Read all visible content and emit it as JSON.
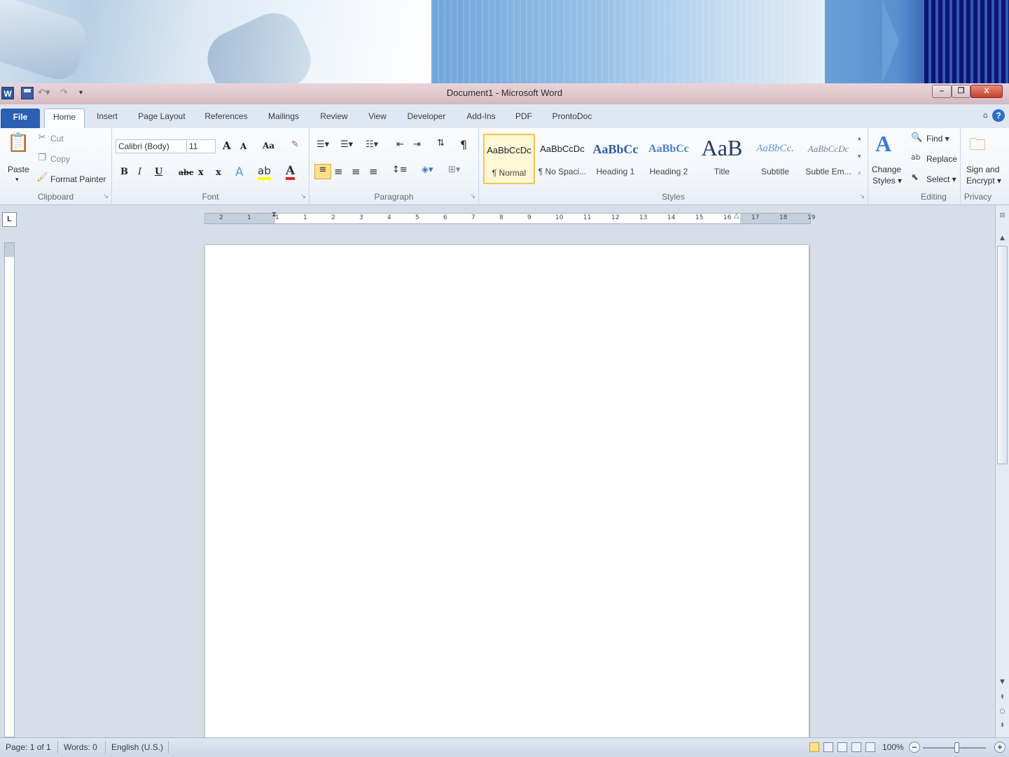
{
  "window": {
    "title": "Document1 - Microsoft Word",
    "min": "–",
    "max": "❐",
    "close": "X"
  },
  "qat": {
    "logo": "W",
    "more": "▾"
  },
  "tabs": [
    "File",
    "Home",
    "Insert",
    "Page Layout",
    "References",
    "Mailings",
    "Review",
    "View",
    "Developer",
    "Add-Ins",
    "PDF",
    "ProntoDoc"
  ],
  "clipboard": {
    "label": "Clipboard",
    "paste": "Paste",
    "cut": "Cut",
    "copy": "Copy",
    "format_painter": "Format Painter"
  },
  "font": {
    "label": "Font",
    "family": "Calibri (Body)",
    "size": "11",
    "grow": "A",
    "shrink": "A",
    "case": "Aa",
    "bold": "B",
    "italic": "I",
    "underline": "U",
    "strike": "abc",
    "sub": "x",
    "sup": "x",
    "font_color": "A"
  },
  "paragraph": {
    "label": "Paragraph",
    "show_marks": "¶"
  },
  "styles": {
    "label": "Styles",
    "items": [
      {
        "sample": "AaBbCcDc",
        "name": "¶ Normal"
      },
      {
        "sample": "AaBbCcDc",
        "name": "¶ No Spaci..."
      },
      {
        "sample": "AaBbCc",
        "name": "Heading 1"
      },
      {
        "sample": "AaBbCc",
        "name": "Heading 2"
      },
      {
        "sample": "AaB",
        "name": "Title"
      },
      {
        "sample": "AaBbCc.",
        "name": "Subtitle"
      },
      {
        "sample": "AaBbCcDc",
        "name": "Subtle Em..."
      }
    ],
    "change": "Change Styles",
    "change_line1": "Change",
    "change_line2": "Styles ▾"
  },
  "editing": {
    "label": "Editing",
    "find": "Find ▾",
    "replace": "Replace",
    "select": "Select ▾"
  },
  "privacy": {
    "label": "Privacy",
    "sign_line1": "Sign and",
    "sign_line2": "Encrypt ▾"
  },
  "ruler": {
    "tab_selector": "L",
    "numbers": [
      "2",
      "1",
      "1",
      "1",
      "2",
      "3",
      "4",
      "5",
      "6",
      "7",
      "8",
      "9",
      "10",
      "11",
      "12",
      "13",
      "14",
      "15",
      "16",
      "17",
      "18",
      "19"
    ]
  },
  "status": {
    "page": "Page: 1 of 1",
    "words": "Words: 0",
    "language": "English (U.S.)",
    "zoom": "100%",
    "zoom_minus": "−",
    "zoom_plus": "+"
  },
  "colors": {
    "file_tab": "#2a5fb2",
    "titlebar": "#dfc6cc",
    "ribbon": "#f1f5fa",
    "workspace": "#d7dee8"
  }
}
